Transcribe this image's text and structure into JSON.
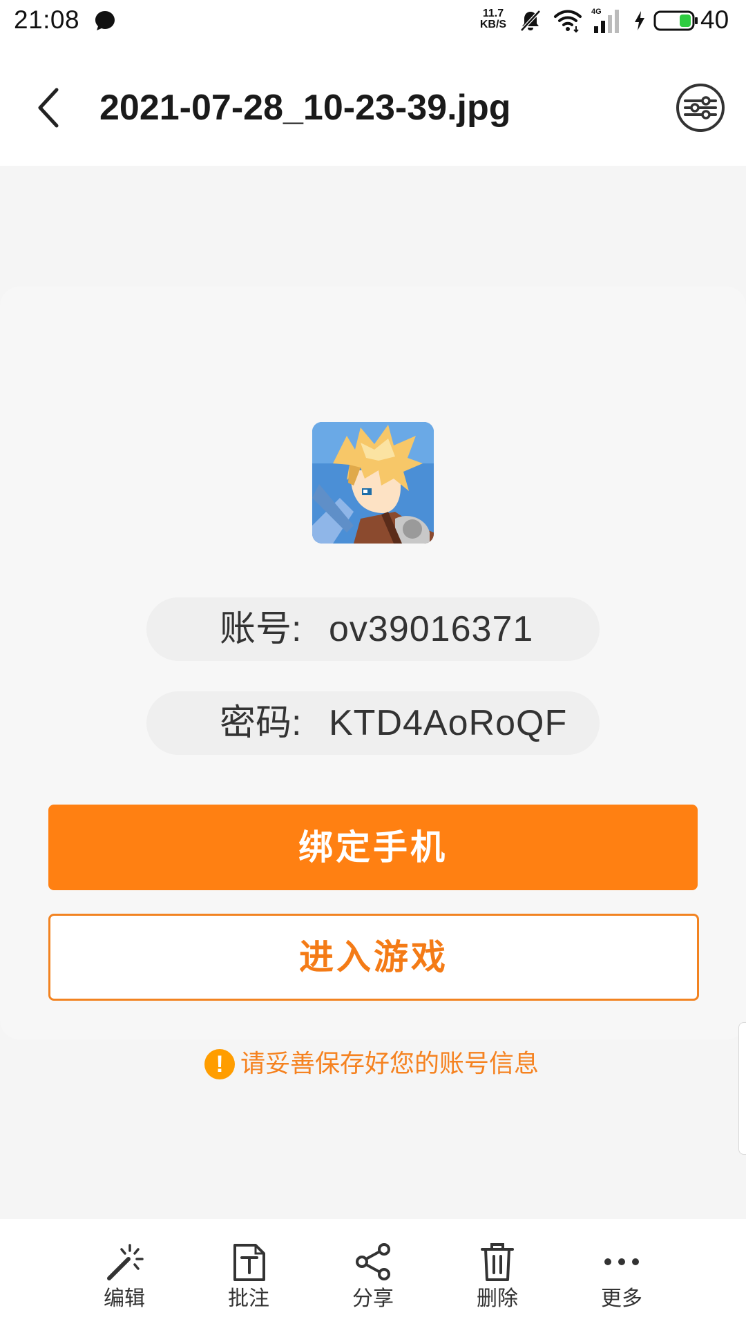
{
  "status_bar": {
    "time": "21:08",
    "net_speed_value": "11.7",
    "net_speed_unit": "KB/S",
    "network_type": "4G",
    "battery_level": "40"
  },
  "header": {
    "title": "2021-07-28_10-23-39.jpg"
  },
  "image_content": {
    "account_label": "账号:",
    "account_value": "ov39016371",
    "password_label": "密码:",
    "password_value": "KTD4AoRoQF",
    "bind_phone_label": "绑定手机",
    "enter_game_label": "进入游戏",
    "warning_symbol": "!",
    "warning_text": "请妥善保存好您的账号信息"
  },
  "toolbar": {
    "items": [
      {
        "label": "编辑",
        "icon": "magic-wand-icon"
      },
      {
        "label": "批注",
        "icon": "annotate-icon"
      },
      {
        "label": "分享",
        "icon": "share-icon"
      },
      {
        "label": "删除",
        "icon": "trash-icon"
      },
      {
        "label": "更多",
        "icon": "more-icon"
      }
    ]
  },
  "colors": {
    "accent_orange": "#ff8012",
    "warning_orange": "#f58220",
    "viewer_background": "#f5f5f5"
  }
}
